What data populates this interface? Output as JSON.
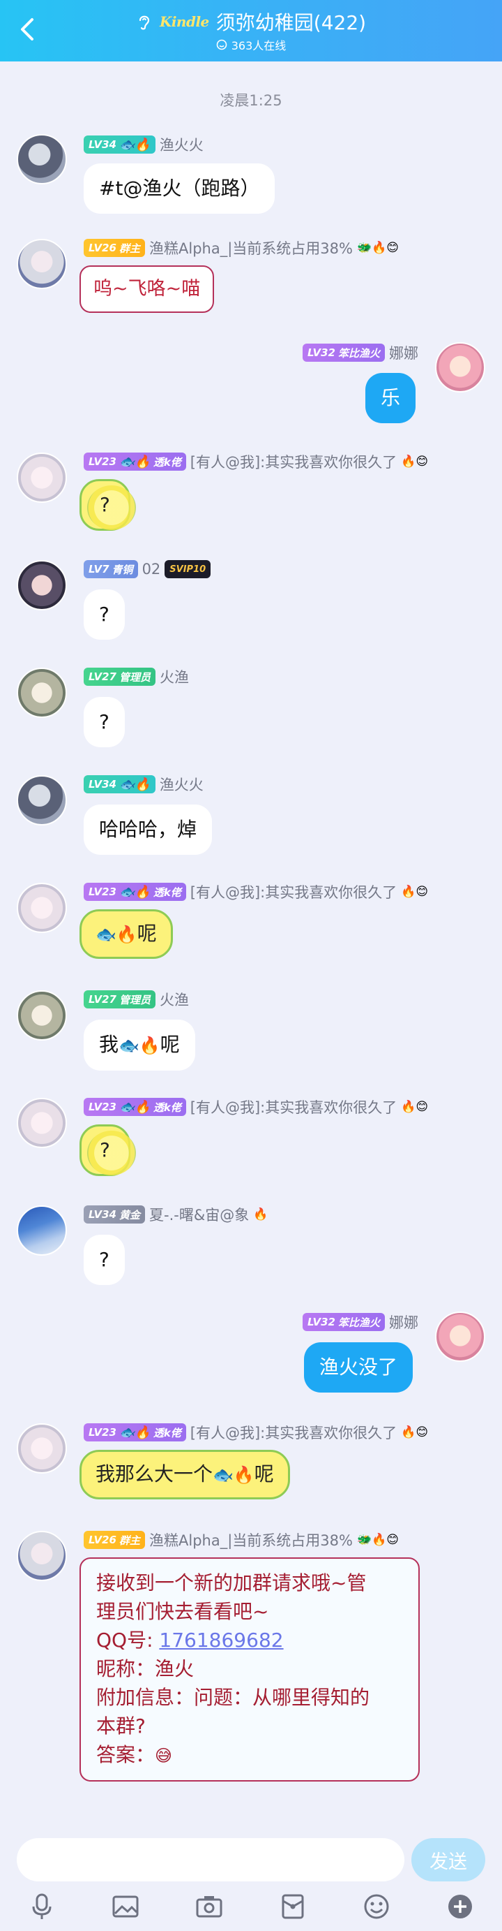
{
  "header": {
    "back_label": "返回",
    "logo_text": "Kindle",
    "title": "须弥幼稚园(422)",
    "online": "363人在线"
  },
  "chat": {
    "timestamp": "凌晨1:25",
    "messages": [
      {
        "side": "left",
        "level": "LV34",
        "badge": "",
        "nick": "渔火火",
        "text": "#t@渔火（跑路）"
      },
      {
        "side": "left",
        "level": "LV26",
        "badge": "群主",
        "nick": "渔糕Alpha_|当前系统占用38%",
        "text": "呜~飞咯~喵"
      },
      {
        "side": "right",
        "level": "LV32",
        "badge": "笨比渔火",
        "nick": "娜娜",
        "text": "乐"
      },
      {
        "side": "left",
        "level": "LV23",
        "badge": "透k佬",
        "nick": "[有人@我]:其实我喜欢你很久了",
        "text": "?"
      },
      {
        "side": "left",
        "level": "LV7",
        "badge": "青铜",
        "nick": "02",
        "vip": "SVIP10",
        "text": "?"
      },
      {
        "side": "left",
        "level": "LV27",
        "badge": "管理员",
        "nick": "火渔",
        "text": "?"
      },
      {
        "side": "left",
        "level": "LV34",
        "badge": "",
        "nick": "渔火火",
        "text": "哈哈哈，焯"
      },
      {
        "side": "left",
        "level": "LV23",
        "badge": "透k佬",
        "nick": "[有人@我]:其实我喜欢你很久了",
        "text": "呢"
      },
      {
        "side": "left",
        "level": "LV27",
        "badge": "管理员",
        "nick": "火渔",
        "text_a": "我",
        "text_b": "呢"
      },
      {
        "side": "left",
        "level": "LV23",
        "badge": "透k佬",
        "nick": "[有人@我]:其实我喜欢你很久了",
        "text": "?"
      },
      {
        "side": "left",
        "level": "LV34",
        "badge": "黄金",
        "nick": "夏-.-曙&宙@象",
        "text": "?"
      },
      {
        "side": "right",
        "level": "LV32",
        "badge": "笨比渔火",
        "nick": "娜娜",
        "text": "渔火没了"
      },
      {
        "side": "left",
        "level": "LV23",
        "badge": "透k佬",
        "nick": "[有人@我]:其实我喜欢你很久了",
        "text_a": "我那么大一个",
        "text_b": "呢"
      },
      {
        "side": "left",
        "level": "LV26",
        "badge": "群主",
        "nick": "渔糕Alpha_|当前系统占用38%",
        "lines": [
          "接收到一个新的加群请求哦~管",
          "理员们快去看看吧~",
          "QQ号: ",
          "昵称：渔火",
          "附加信息：问题：从哪里得知的",
          "本群?",
          "答案："
        ],
        "qq": "1761869682"
      }
    ]
  },
  "input": {
    "placeholder": "",
    "send_label": "发送"
  },
  "icons": {
    "back": "chevron-left-icon",
    "ear": "ear-icon",
    "online": "online-icon",
    "mic": "microphone-icon",
    "image": "image-icon",
    "camera": "camera-icon",
    "envelope": "red-packet-icon",
    "emoji": "emoji-icon",
    "plus": "plus-icon"
  },
  "colors": {
    "header_start": "#27c4f4",
    "header_end": "#45a4f7",
    "bubble_blue": "#1ea8f4",
    "background": "#eef0fa",
    "send_button": "#b5e3fb"
  }
}
